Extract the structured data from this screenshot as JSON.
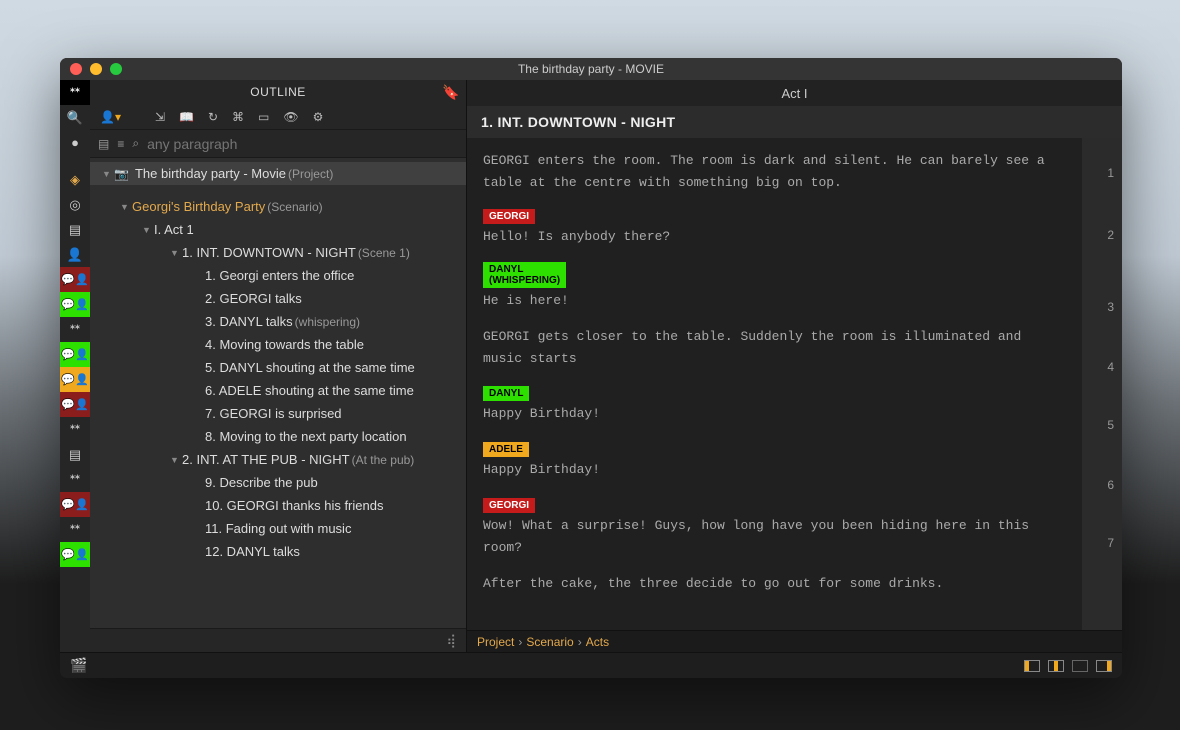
{
  "window": {
    "title": "The birthday party - MOVIE"
  },
  "outline": {
    "header": "OUTLINE",
    "filter_placeholder": "any paragraph",
    "project": {
      "label": "The birthday party - Movie",
      "meta": "(Project)"
    },
    "scenario": {
      "label": "Georgi's Birthday Party",
      "meta": "(Scenario)"
    },
    "act": {
      "label": "I. Act 1"
    },
    "scene1": {
      "label": "1. INT.  DOWNTOWN - NIGHT",
      "meta": "(Scene 1)"
    },
    "scene2": {
      "label": "2. INT.  AT THE PUB - NIGHT",
      "meta": "(At the pub)"
    },
    "beats": [
      "1. Georgi enters the office",
      "2. GEORGI talks",
      "3. DANYL talks",
      "4. Moving towards the table",
      "5. DANYL shouting at the same time",
      "6. ADELE shouting at the same time",
      "7. GEORGI is surprised",
      "8. Moving to the next party location"
    ],
    "beat3_meta": "(whispering)",
    "beats2": [
      "9. Describe the pub",
      "10. GEORGI thanks his friends",
      "11. Fading out with music",
      "12. DANYL talks"
    ]
  },
  "editor": {
    "act_label": "Act I",
    "scene_heading": "1. INT.  DOWNTOWN - NIGHT",
    "action1": "GEORGI enters the room. The room is dark and silent. He can barely see a table at the centre with something big on top.",
    "chars": {
      "georgi": "GEORGI",
      "danyl": "DANYL",
      "adele": "ADELE",
      "whispering": "(WHISPERING)"
    },
    "dialog1": "Hello! Is anybody there?",
    "dialog2": "He is here!",
    "action2": "GEORGI gets closer to the table. Suddenly the room is illuminated and music starts",
    "dialog3": "Happy Birthday!",
    "dialog4": "Happy Birthday!",
    "dialog5": "Wow! What a surprise! Guys, how long have you been hiding here in this room?",
    "action3": "After the cake, the three decide to go out for some drinks.",
    "gutter": [
      "1",
      "2",
      "3",
      "4",
      "5",
      "6",
      "7"
    ]
  },
  "breadcrumb": {
    "p1": "Project",
    "p2": "Scenario",
    "p3": "Acts",
    "sep": "›"
  }
}
